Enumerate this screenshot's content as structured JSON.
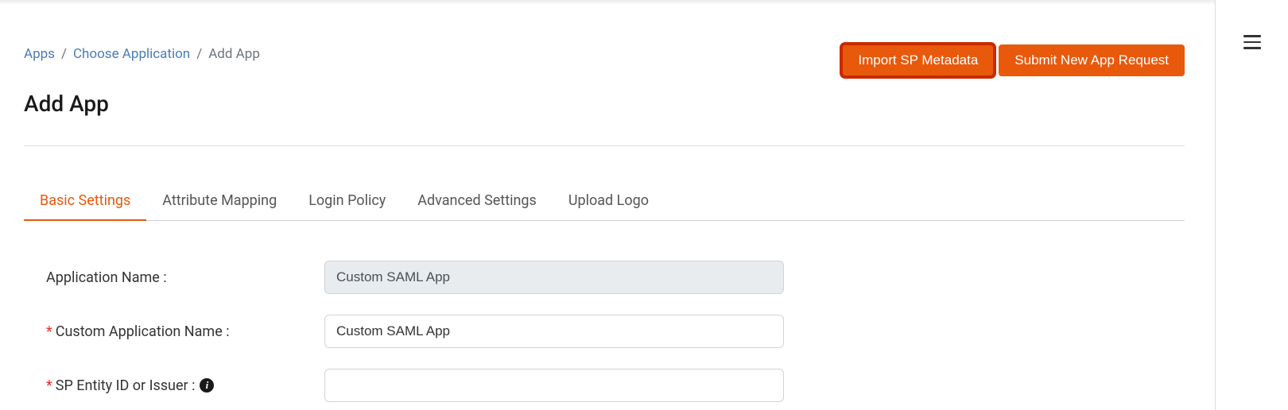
{
  "breadcrumb": {
    "items": [
      {
        "label": "Apps",
        "link": true
      },
      {
        "label": "Choose Application",
        "link": true
      },
      {
        "label": "Add App",
        "link": false
      }
    ],
    "sep": "/"
  },
  "actions": {
    "import": "Import SP Metadata",
    "submit": "Submit New App Request"
  },
  "page_title": "Add App",
  "tabs": [
    {
      "label": "Basic Settings",
      "active": true
    },
    {
      "label": "Attribute Mapping",
      "active": false
    },
    {
      "label": "Login Policy",
      "active": false
    },
    {
      "label": "Advanced Settings",
      "active": false
    },
    {
      "label": "Upload Logo",
      "active": false
    }
  ],
  "form": {
    "app_name_label": "Application Name :",
    "app_name_value": "Custom SAML App",
    "custom_name_label": "Custom Application Name :",
    "custom_name_value": "Custom SAML App",
    "sp_entity_label": "SP Entity ID or Issuer :",
    "sp_entity_value": ""
  },
  "info_glyph": "i"
}
